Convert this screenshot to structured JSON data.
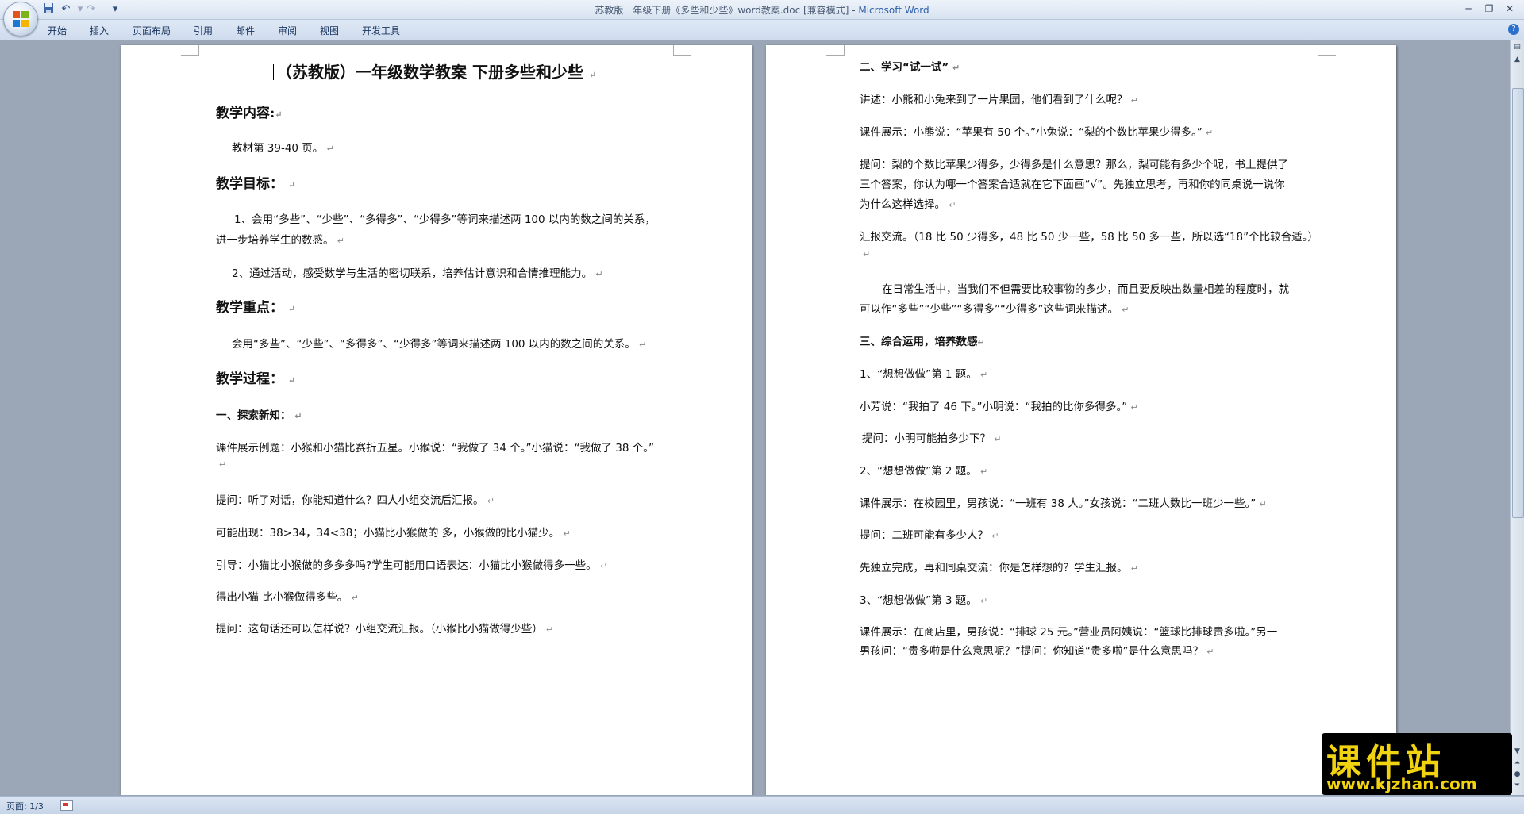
{
  "window": {
    "title_doc": "苏教版一年级下册《多些和少些》word教案.doc [兼容模式]",
    "title_sep": " - ",
    "title_app": "Microsoft Word"
  },
  "quick_access": {
    "save_icon": "save-icon",
    "undo_icon": "undo-icon",
    "redo_icon": "redo-icon",
    "customize_icon": "customize-icon"
  },
  "ribbon": {
    "tabs": [
      "开始",
      "插入",
      "页面布局",
      "引用",
      "邮件",
      "审阅",
      "视图",
      "开发工具"
    ]
  },
  "pages": {
    "left": {
      "title": "（苏教版）一年级数学教案  下册多些和少些",
      "lines": [
        "教学内容:",
        "教材第 39-40 页。",
        "教学目标：",
        "1、会用“多些”、“少些”、“多得多”、“少得多”等词来描述两 100 以内的数之间的关系，",
        "进一步培养学生的数感。",
        "2、通过活动，感受数学与生活的密切联系，培养估计意识和合情推理能力。",
        "教学重点：",
        "会用“多些”、“少些”、“多得多”、“少得多”等词来描述两 100 以内的数之间的关系。",
        "教学过程：",
        "一、探索新知：",
        "课件展示例题：小猴和小猫比赛折五星。小猴说：“我做了 34 个。”小猫说：“我做了 38 个。”",
        "",
        "提问：听了对话，你能知道什么？四人小组交流后汇报。",
        "可能出现：38>34，34<38；小猫比小猴做的      多，小猴做的比小猫少。",
        "引导：小猫比小猴做的多多多吗?学生可能用口语表达：小猫比小猴做得多一些。",
        "得出小猫  比小猴做得多些。",
        "提问：这句话还可以怎样说？小组交流汇报。（小猴比小猫做得少些）"
      ]
    },
    "right": {
      "lines": [
        "二、学习“试一试”",
        "讲述：小熊和小兔来到了一片果园，他们看到了什么呢？",
        "课件展示：小熊说：“苹果有 50 个。”小兔说：“梨的个数比苹果少得多。”",
        "提问：梨的个数比苹果少得多，少得多是什么意思？那么，梨可能有多少个呢，书上提供了",
        "三个答案，你认为哪一个答案合适就在它下面画“√”。先独立思考，再和你的同桌说一说你",
        "为什么这样选择。",
        "汇报交流。（18 比 50 少得多，48 比 50 少一些，58 比 50 多一些，所以选“18”个比较合适。）",
        "",
        "在日常生活中，当我们不但需要比较事物的多少，而且要反映出数量相差的程度时，就",
        "可以作“多些”“少些”“多得多”“少得多”这些词来描述。",
        "三、综合运用，培养数感",
        "1、“想想做做”第 1 题。",
        "小芳说：“我拍了 46 下。”小明说：“我拍的比你多得多。”",
        "提问：小明可能拍多少下？",
        "2、“想想做做”第 2 题。",
        "课件展示：在校园里，男孩说：“一班有 38 人。”女孩说：“二班人数比一班少一些。”",
        "提问：二班可能有多少人？",
        "先独立完成，再和同桌交流：你是怎样想的？学生汇报。",
        "3、“想想做做”第 3 题。",
        "课件展示：在商店里，男孩说：“排球 25 元。”营业员阿姨说：“篮球比排球贵多啦。”另一",
        "男孩问：“贵多啦是什么意思呢？”提问：你知道“贵多啦”是什么意思吗？"
      ]
    }
  },
  "status": {
    "page": "页面: 1/3"
  },
  "watermark": {
    "cn": "课件站",
    "url": "www.kjzhan.com"
  },
  "icons": {
    "office_button": "office-logo-icon",
    "help": "help-icon",
    "paragraph_mark": "↵"
  }
}
